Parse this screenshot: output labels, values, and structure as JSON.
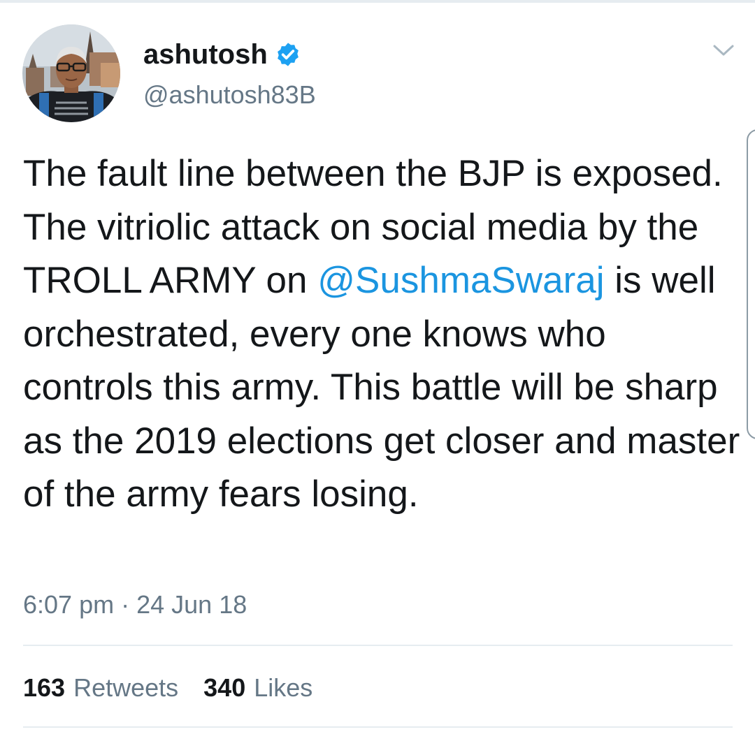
{
  "tweet": {
    "author": {
      "display_name": "ashutosh",
      "handle": "@ashutosh83B",
      "verified": true,
      "avatar_icon": "profile-photo"
    },
    "menu_icon": "chevron-down-icon",
    "text": {
      "part1": "The fault line between the BJP is exposed. The vitriolic attack on social media by the TROLL ARMY on ",
      "mention": "@SushmaSwaraj",
      "part2": " is well orchestrated, every one knows who controls this army. This battle will be sharp as the 2019 elections get closer and master of the army fears losing."
    },
    "time": "6:07 pm",
    "separator": "·",
    "date": "24 Jun 18",
    "stats": {
      "retweets_count": "163",
      "retweets_label": "Retweets",
      "likes_count": "340",
      "likes_label": "Likes"
    }
  },
  "colors": {
    "text_primary": "#14171a",
    "text_secondary": "#657786",
    "link": "#1b95e0",
    "verified_badge": "#1da1f2",
    "divider": "#e6ecf0"
  }
}
